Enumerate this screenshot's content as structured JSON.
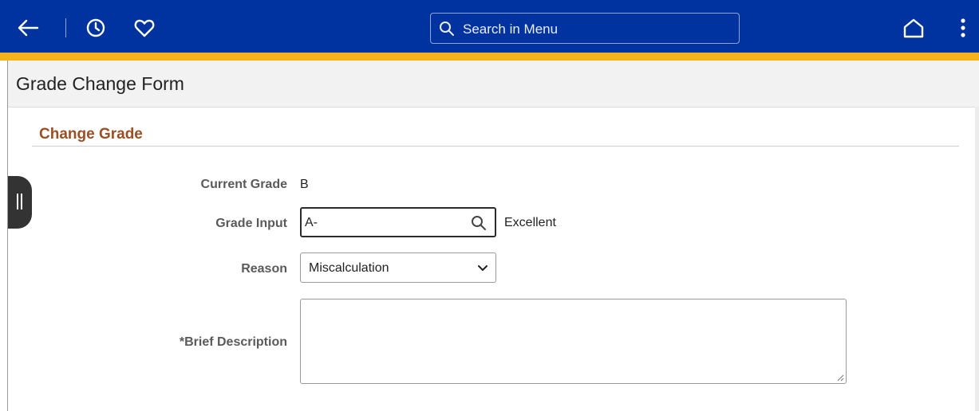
{
  "topbar": {
    "search_placeholder": "Search in Menu",
    "icons": [
      "back-arrow-icon",
      "history-icon",
      "favorites-heart-icon",
      "search-icon",
      "home-icon",
      "more-actions-icon"
    ],
    "colors": {
      "bar": "#0033a0",
      "accent": "#f5b21b"
    }
  },
  "page": {
    "title": "Grade Change Form"
  },
  "section": {
    "title": "Change Grade",
    "title_color": "#9b4f24"
  },
  "form": {
    "current_grade_label": "Current Grade",
    "current_grade_value": "B",
    "grade_input_label": "Grade Input",
    "grade_input_value": "A-",
    "grade_input_description": "Excellent",
    "reason_label": "Reason",
    "reason_value": "Miscalculation",
    "description_label": "*Brief Description",
    "description_value": ""
  }
}
